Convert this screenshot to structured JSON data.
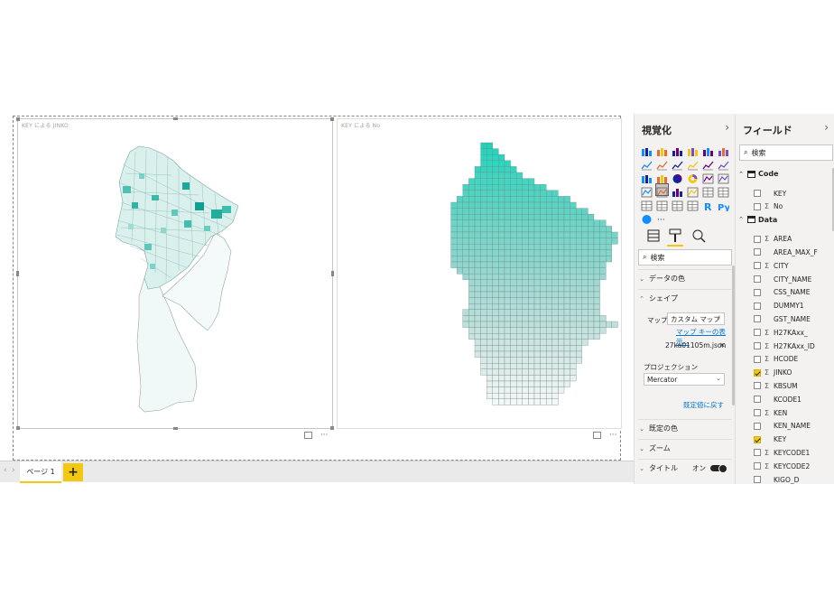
{
  "canvas": {
    "visual_left": {
      "title": "KEY による JINKO"
    },
    "visual_right": {
      "title": "KEY による No"
    },
    "more_label": "···",
    "tabs": {
      "prev": "‹",
      "next": "›",
      "page_label": "ページ 1",
      "add_label": "+"
    }
  },
  "viz_pane": {
    "title": "視覚化",
    "collapse_glyph": "›",
    "icons": [
      "stacked-bar-icon",
      "stacked-column-icon",
      "clustered-bar-icon",
      "clustered-column-icon",
      "100-stacked-bar-icon",
      "100-stacked-column-icon",
      "line-chart-icon",
      "area-chart-icon",
      "stacked-area-icon",
      "line-column-icon",
      "line-clustered-column-icon",
      "ribbon-chart-icon",
      "waterfall-icon",
      "scatter-icon",
      "pie-chart-icon",
      "donut-chart-icon",
      "treemap-icon",
      "map-icon",
      "filled-map-icon",
      "shape-map-icon",
      "funnel-icon",
      "gauge-icon",
      "card-icon",
      "multirow-card-icon",
      "kpi-icon",
      "slicer-icon",
      "table-icon",
      "matrix-icon",
      "r-visual-icon",
      "python-visual-icon",
      "arcgis-icon",
      "more-visuals-icon"
    ],
    "selected_icon": 19,
    "search_placeholder": "検索",
    "sections": {
      "data_colors": "データの色",
      "shape": "シェイプ",
      "default_colors": "既定の色",
      "zoom": "ズーム",
      "title": "タイトル"
    },
    "shape": {
      "map_label": "マップ",
      "map_value": "カスタム マップ",
      "map_keys_link": "マップ キーの表示...",
      "file_name": "27ka01105m.json",
      "remove_glyph": "✕",
      "projection_label": "プロジェクション",
      "projection_value": "Mercator",
      "reset_link": "既定値に戻す"
    },
    "title_toggle_label": "オン"
  },
  "fields_pane": {
    "title": "フィールド",
    "collapse_glyph": "›",
    "search_placeholder": "検索",
    "tables": [
      {
        "name": "Code",
        "fields": [
          {
            "name": "KEY",
            "sigma": false,
            "checked": false
          },
          {
            "name": "No",
            "sigma": true,
            "checked": false
          }
        ]
      },
      {
        "name": "Data",
        "fields": [
          {
            "name": "AREA",
            "sigma": true,
            "checked": false
          },
          {
            "name": "AREA_MAX_F",
            "sigma": false,
            "checked": false
          },
          {
            "name": "CITY",
            "sigma": true,
            "checked": false
          },
          {
            "name": "CITY_NAME",
            "sigma": false,
            "checked": false
          },
          {
            "name": "CSS_NAME",
            "sigma": false,
            "checked": false
          },
          {
            "name": "DUMMY1",
            "sigma": false,
            "checked": false
          },
          {
            "name": "GST_NAME",
            "sigma": false,
            "checked": false
          },
          {
            "name": "H27KAxx_",
            "sigma": true,
            "checked": false
          },
          {
            "name": "H27KAxx_ID",
            "sigma": true,
            "checked": false
          },
          {
            "name": "HCODE",
            "sigma": true,
            "checked": false
          },
          {
            "name": "JINKO",
            "sigma": true,
            "checked": true
          },
          {
            "name": "KBSUM",
            "sigma": true,
            "checked": false
          },
          {
            "name": "KCODE1",
            "sigma": false,
            "checked": false
          },
          {
            "name": "KEN",
            "sigma": true,
            "checked": false
          },
          {
            "name": "KEN_NAME",
            "sigma": false,
            "checked": false
          },
          {
            "name": "KEY",
            "sigma": false,
            "checked": true
          },
          {
            "name": "KEYCODE1",
            "sigma": true,
            "checked": false
          },
          {
            "name": "KEYCODE2",
            "sigma": true,
            "checked": false
          },
          {
            "name": "KIGO_D",
            "sigma": false,
            "checked": false
          }
        ]
      }
    ]
  },
  "colors": {
    "accent": "#f2c811",
    "map_teal": "#1db5a5",
    "map_light": "#eef8f7",
    "link": "#0078d4"
  }
}
